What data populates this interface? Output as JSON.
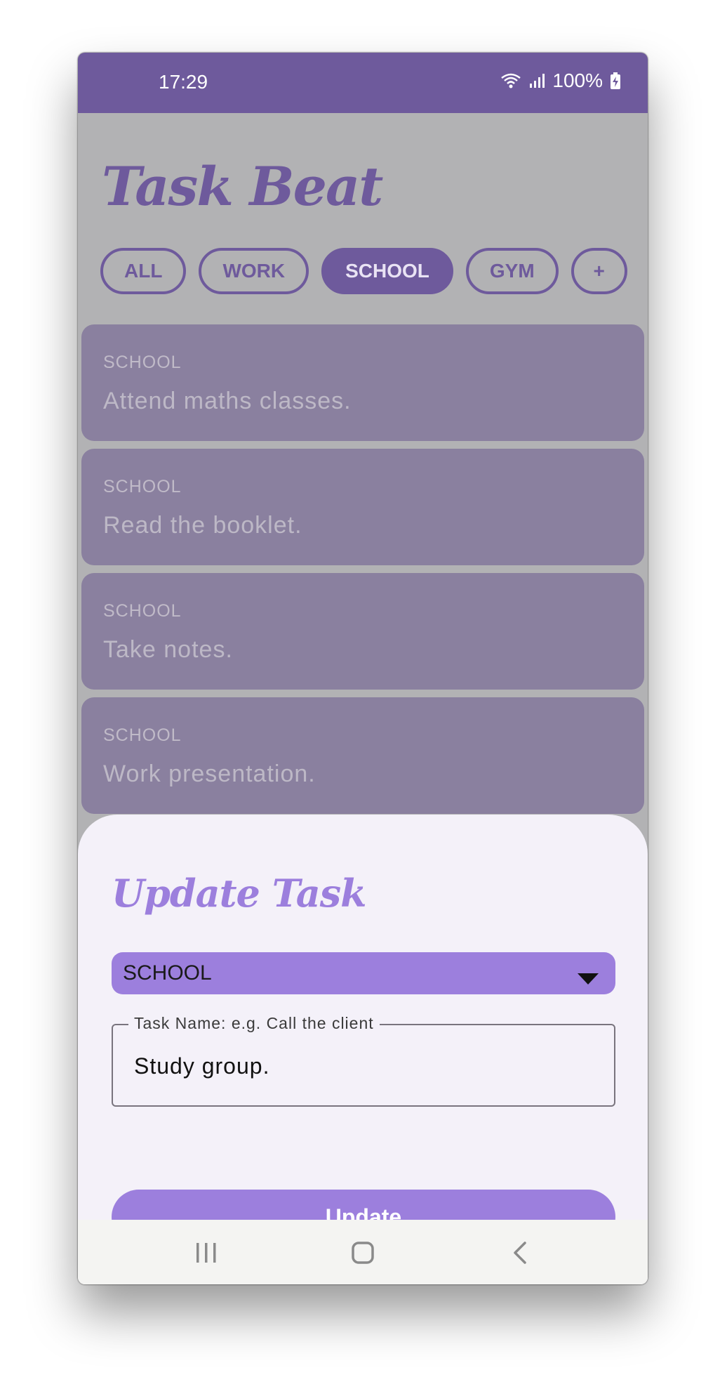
{
  "status_bar": {
    "time": "17:29",
    "battery": "100%",
    "icons": [
      "wifi-icon",
      "signal-icon",
      "battery-charging-icon"
    ]
  },
  "app": {
    "title": "Task Beat"
  },
  "filters": {
    "chips": [
      {
        "label": "ALL",
        "active": false
      },
      {
        "label": "WORK",
        "active": false
      },
      {
        "label": "SCHOOL",
        "active": true
      },
      {
        "label": "GYM",
        "active": false
      },
      {
        "label": "+",
        "active": false
      }
    ]
  },
  "tasks": [
    {
      "category": "SCHOOL",
      "name": "Attend maths classes."
    },
    {
      "category": "SCHOOL",
      "name": "Read the booklet."
    },
    {
      "category": "SCHOOL",
      "name": "Take notes."
    },
    {
      "category": "SCHOOL",
      "name": "Work presentation."
    }
  ],
  "sheet": {
    "title": "Update Task",
    "category_select": {
      "selected": "SCHOOL"
    },
    "task_field": {
      "label": "Task Name: e.g. Call the client",
      "value": "Study group."
    },
    "update_button_label": "Update"
  },
  "nav_bar": {
    "icons": [
      "recent-apps-icon",
      "home-icon",
      "back-icon"
    ]
  },
  "colors": {
    "primary": "#6e5a9c",
    "accent": "#9c7fdd",
    "sheet_background": "#f4f1f9",
    "scrim_card": "#8a809f"
  }
}
